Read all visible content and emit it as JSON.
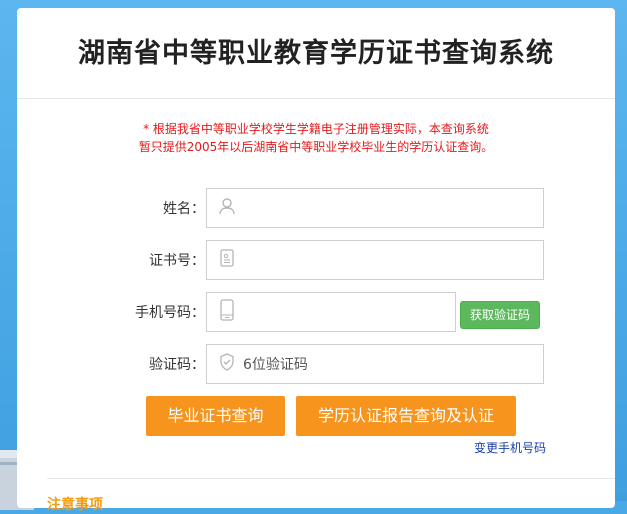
{
  "header": {
    "title": "湖南省中等职业教育学历证书查询系统"
  },
  "notice": {
    "line1": "* 根据我省中等职业学校学生学籍电子注册管理实际，本查询系统",
    "line2": "暂只提供2005年以后湖南省中等职业学校毕业生的学历认证查询。"
  },
  "form": {
    "name_label": "姓名：",
    "cert_label": "证书号：",
    "phone_label": "手机号码：",
    "code_label": "验证码：",
    "code_placeholder": "6位验证码",
    "get_code_button": "获取验证码"
  },
  "actions": {
    "cert_query": "毕业证书查询",
    "report_query": "学历认证报告查询及认证",
    "change_phone": "变更手机号码"
  },
  "footer": {
    "partial_heading": "注意事项"
  },
  "colors": {
    "accent_orange": "#f7941d",
    "notice_red": "#e4191c",
    "sms_green": "#5cb85c",
    "background_blue": "#4aa8e6"
  },
  "icons": {
    "name": "user-icon",
    "cert": "id-card-icon",
    "phone": "phone-icon",
    "code": "shield-icon"
  }
}
